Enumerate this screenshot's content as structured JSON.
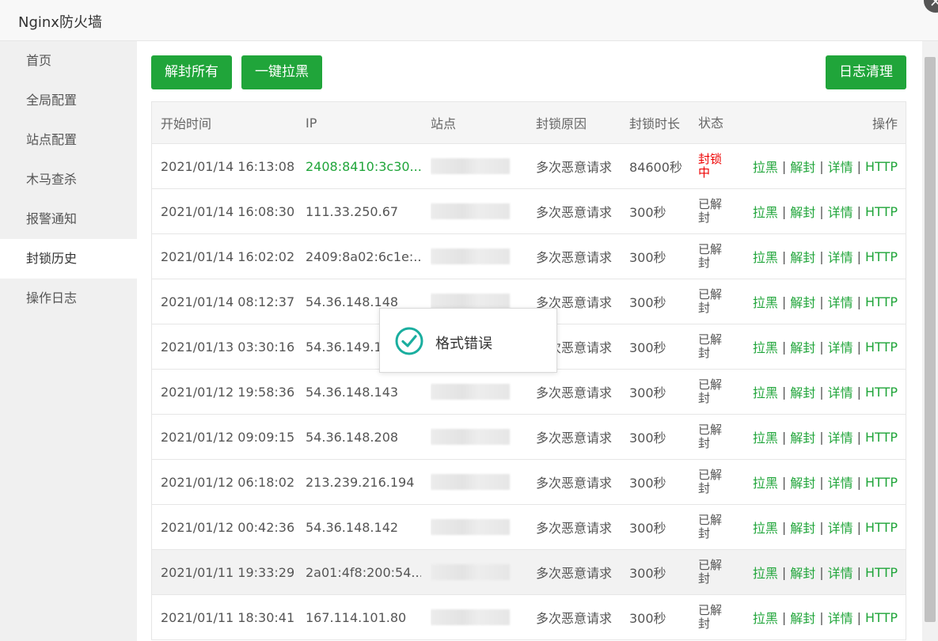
{
  "window": {
    "title": "Nginx防火墙",
    "close_glyph": "×"
  },
  "sidebar": {
    "items": [
      {
        "label": "首页",
        "name": "sidebar-item-home"
      },
      {
        "label": "全局配置",
        "name": "sidebar-item-global-config"
      },
      {
        "label": "站点配置",
        "name": "sidebar-item-site-config"
      },
      {
        "label": "木马查杀",
        "name": "sidebar-item-trojan-scan"
      },
      {
        "label": "报警通知",
        "name": "sidebar-item-alert-notify"
      },
      {
        "label": "封锁历史",
        "name": "sidebar-item-block-history",
        "active": true
      },
      {
        "label": "操作日志",
        "name": "sidebar-item-operation-log"
      }
    ]
  },
  "toolbar": {
    "unblock_all_label": "解封所有",
    "blacklist_label": "一键拉黑",
    "clear_log_label": "日志清理"
  },
  "table": {
    "headers": [
      "开始时间",
      "IP",
      "站点",
      "封锁原因",
      "封锁时长",
      "状态",
      "操作"
    ],
    "rows": [
      {
        "time": "2021/01/14 16:13:08",
        "ip": "2408:8410:3c30...",
        "ip_highlight": true,
        "reason": "多次恶意请求",
        "duration": "84600秒",
        "status": "封锁中",
        "status_active": true
      },
      {
        "time": "2021/01/14 16:08:30",
        "ip": "111.33.250.67",
        "reason": "多次恶意请求",
        "duration": "300秒",
        "status": "已解封"
      },
      {
        "time": "2021/01/14 16:02:02",
        "ip": "2409:8a02:6c1e:...",
        "reason": "多次恶意请求",
        "duration": "300秒",
        "status": "已解封"
      },
      {
        "time": "2021/01/14 08:12:37",
        "ip": "54.36.148.148",
        "reason": "多次恶意请求",
        "duration": "300秒",
        "status": "已解封"
      },
      {
        "time": "2021/01/13 03:30:16",
        "ip": "54.36.149.19",
        "reason": "多次恶意请求",
        "duration": "300秒",
        "status": "已解封"
      },
      {
        "time": "2021/01/12 19:58:36",
        "ip": "54.36.148.143",
        "reason": "多次恶意请求",
        "duration": "300秒",
        "status": "已解封"
      },
      {
        "time": "2021/01/12 09:09:15",
        "ip": "54.36.148.208",
        "reason": "多次恶意请求",
        "duration": "300秒",
        "status": "已解封"
      },
      {
        "time": "2021/01/12 06:18:02",
        "ip": "213.239.216.194",
        "reason": "多次恶意请求",
        "duration": "300秒",
        "status": "已解封"
      },
      {
        "time": "2021/01/12 00:42:36",
        "ip": "54.36.148.142",
        "reason": "多次恶意请求",
        "duration": "300秒",
        "status": "已解封"
      },
      {
        "time": "2021/01/11 19:33:29",
        "ip": "2a01:4f8:200:54...",
        "reason": "多次恶意请求",
        "duration": "300秒",
        "status": "已解封",
        "highlight": true
      },
      {
        "time": "2021/01/11 18:30:41",
        "ip": "167.114.101.80",
        "reason": "多次恶意请求",
        "duration": "300秒",
        "status": "已解封"
      }
    ],
    "ops": [
      "拉黑",
      "解封",
      "详情",
      "HTTP"
    ],
    "op_separator": "|"
  },
  "toast": {
    "message": "格式错误",
    "icon": "check-circle-icon"
  },
  "colors": {
    "accent": "#20a53a",
    "danger": "#ee0000"
  }
}
